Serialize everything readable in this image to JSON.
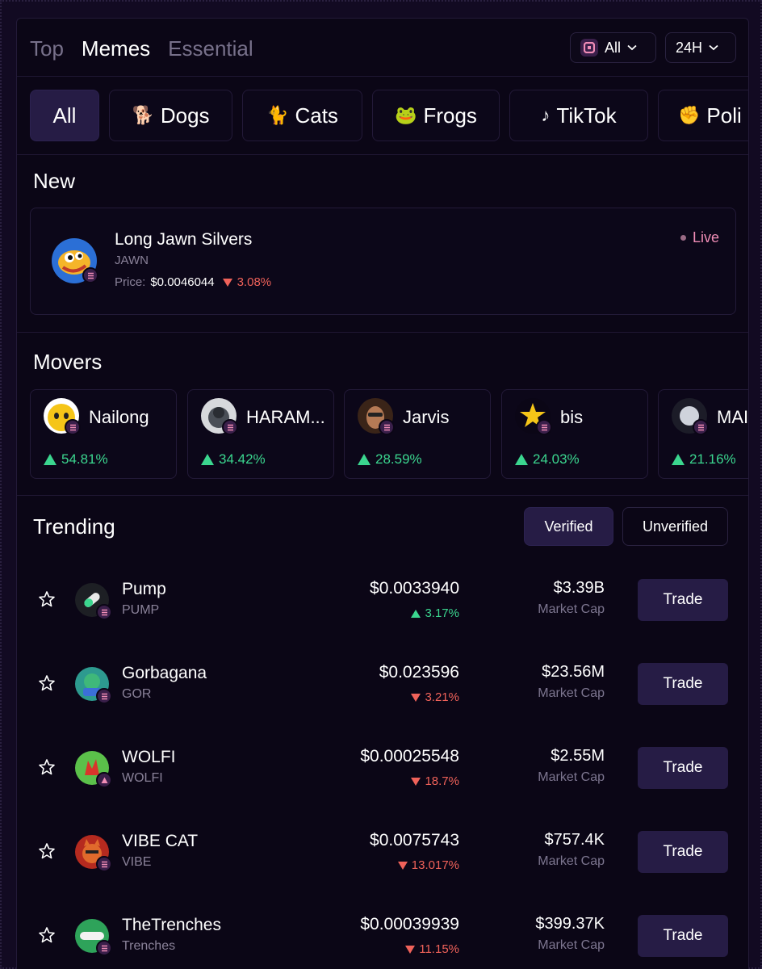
{
  "header": {
    "tabs": [
      {
        "label": "Top",
        "active": false
      },
      {
        "label": "Memes",
        "active": true
      },
      {
        "label": "Essential",
        "active": false
      }
    ],
    "chain_select": "All",
    "time_select": "24H"
  },
  "categories": [
    {
      "label": "All",
      "emoji": "",
      "active": true
    },
    {
      "label": "Dogs",
      "emoji": "🐕",
      "active": false
    },
    {
      "label": "Cats",
      "emoji": "🐈",
      "active": false
    },
    {
      "label": "Frogs",
      "emoji": "🐸",
      "active": false
    },
    {
      "label": "TikTok",
      "emoji": "♪",
      "active": false
    },
    {
      "label": "Poli",
      "emoji": "✊",
      "active": false
    }
  ],
  "new_section": {
    "title": "New",
    "token": {
      "name": "Long Jawn Silvers",
      "symbol": "JAWN",
      "price_label": "Price:",
      "price": "$0.0046044",
      "change": "3.08%",
      "status": "Live"
    }
  },
  "movers_section": {
    "title": "Movers",
    "items": [
      {
        "name": "Nailong",
        "change": "54.81%"
      },
      {
        "name": "HARAM...",
        "change": "34.42%"
      },
      {
        "name": "Jarvis",
        "change": "28.59%"
      },
      {
        "name": "bis",
        "change": "24.03%"
      },
      {
        "name": "MAI",
        "change": "21.16%"
      }
    ]
  },
  "trending_section": {
    "title": "Trending",
    "filters": {
      "verified": "Verified",
      "unverified": "Unverified"
    },
    "market_cap_label": "Market Cap",
    "trade_label": "Trade",
    "rows": [
      {
        "name": "Pump",
        "symbol": "PUMP",
        "price": "$0.0033940",
        "change": "3.17%",
        "direction": "up",
        "market_cap": "$3.39B"
      },
      {
        "name": "Gorbagana",
        "symbol": "GOR",
        "price": "$0.023596",
        "change": "3.21%",
        "direction": "down",
        "market_cap": "$23.56M"
      },
      {
        "name": "WOLFI",
        "symbol": "WOLFI",
        "price": "$0.00025548",
        "change": "18.7%",
        "direction": "down",
        "market_cap": "$2.55M"
      },
      {
        "name": "VIBE CAT",
        "symbol": "VIBE",
        "price": "$0.0075743",
        "change": "13.017%",
        "direction": "down",
        "market_cap": "$757.4K"
      },
      {
        "name": "TheTrenches",
        "symbol": "Trenches",
        "price": "$0.00039939",
        "change": "11.15%",
        "direction": "down",
        "market_cap": "$399.37K"
      }
    ]
  },
  "colors": {
    "background": "#0b0616",
    "accent_button": "#261c45",
    "positive": "#3bd68f",
    "negative": "#f0625a",
    "live": "#f08db6"
  }
}
